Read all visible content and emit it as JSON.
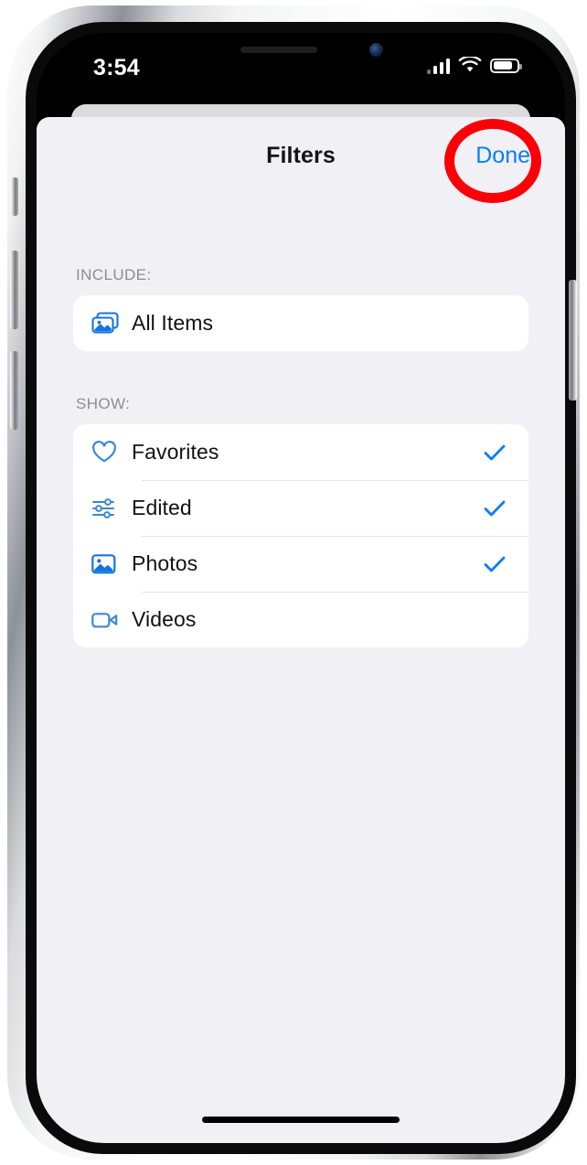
{
  "status_bar": {
    "time": "3:54",
    "cellular_icon": "cellular-signal-icon",
    "wifi_icon": "wifi-icon",
    "battery_icon": "battery-icon",
    "battery_level_percent": 72
  },
  "sheet": {
    "title": "Filters",
    "done_label": "Done",
    "accent_color": "#0a7cff",
    "background_color": "#f1f1f5",
    "card_color": "#ffffff"
  },
  "sections": [
    {
      "label": "INCLUDE:",
      "rows": [
        {
          "label": "All Items",
          "icon": "photo-stack-icon",
          "checked": false
        }
      ]
    },
    {
      "label": "SHOW:",
      "rows": [
        {
          "label": "Favorites",
          "icon": "heart-icon",
          "checked": true
        },
        {
          "label": "Edited",
          "icon": "sliders-icon",
          "checked": true
        },
        {
          "label": "Photos",
          "icon": "photo-icon",
          "checked": true
        },
        {
          "label": "Videos",
          "icon": "video-camera-icon",
          "checked": false
        }
      ]
    }
  ],
  "annotation": {
    "shape": "circle",
    "color": "#fb0007",
    "target": "Done"
  },
  "home_indicator": "home-indicator"
}
